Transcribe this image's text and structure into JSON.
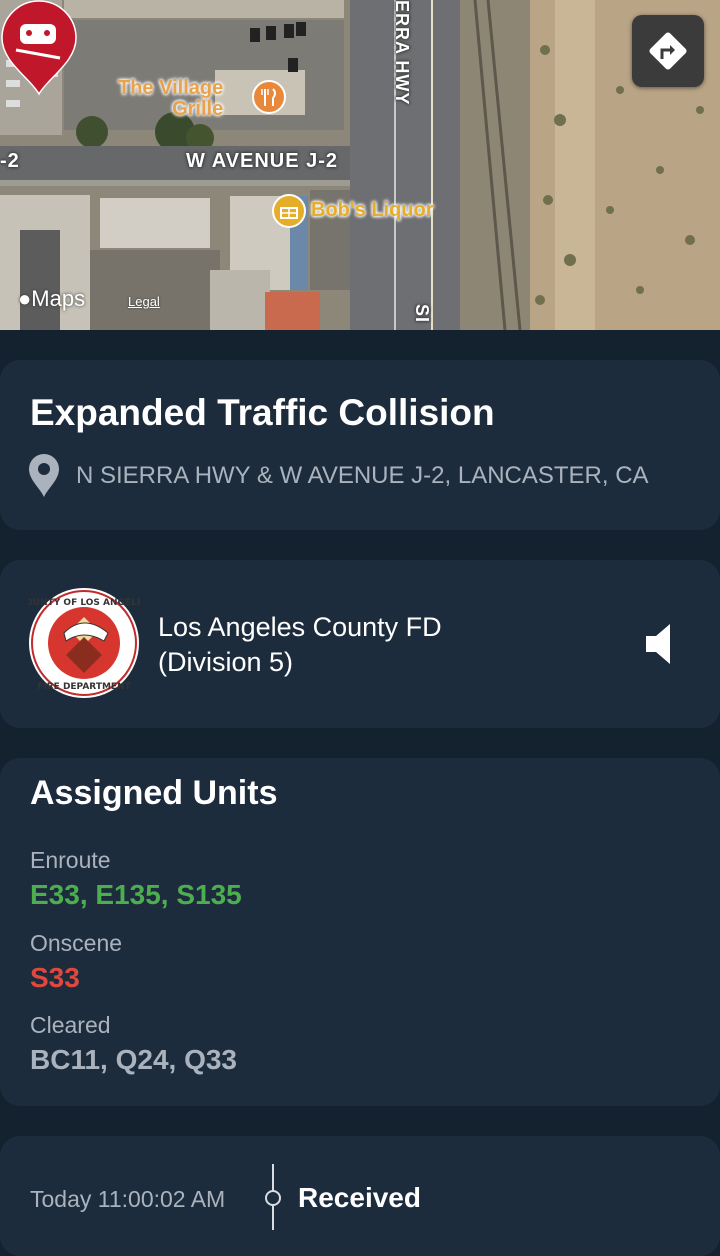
{
  "map": {
    "poi": [
      {
        "name": "The Village Grille",
        "line1": "The Village",
        "line2": "Grille",
        "icon": "fork-knife-icon"
      },
      {
        "name": "Bob's Liquor",
        "icon": "basket-icon"
      }
    ],
    "streets": {
      "avenue": "W AVENUE J-2",
      "avenue_left": "-2",
      "highway": "ERRA HWY",
      "highway_bottom": "SI"
    },
    "brand": "Maps",
    "legal": "Legal",
    "incident_pin_icon": "car-crash-icon",
    "directions_icon": "directions-icon"
  },
  "incident": {
    "title": "Expanded Traffic Collision",
    "address": "N SIERRA HWY & W AVENUE J-2, LANCASTER, CA"
  },
  "agency": {
    "line1": "Los Angeles County FD",
    "line2": "(Division 5)",
    "seal_text_top": "COUNTY OF LOS ANGELES",
    "seal_text_bottom": "FIRE DEPARTMENT"
  },
  "units": {
    "heading": "Assigned Units",
    "groups": [
      {
        "label": "Enroute",
        "value": "E33, E135, S135",
        "color": "#4cae4f"
      },
      {
        "label": "Onscene",
        "value": "S33",
        "color": "#e0473f"
      },
      {
        "label": "Cleared",
        "value": "BC11, Q24, Q33",
        "color": "#aab3bd"
      }
    ]
  },
  "timeline": [
    {
      "time": "Today 11:00:02 AM",
      "status": "Received"
    }
  ],
  "colors": {
    "background": "#142230",
    "card": "#1d2c3d",
    "muted_text": "#aab3bd",
    "pin": "#c0182a"
  }
}
